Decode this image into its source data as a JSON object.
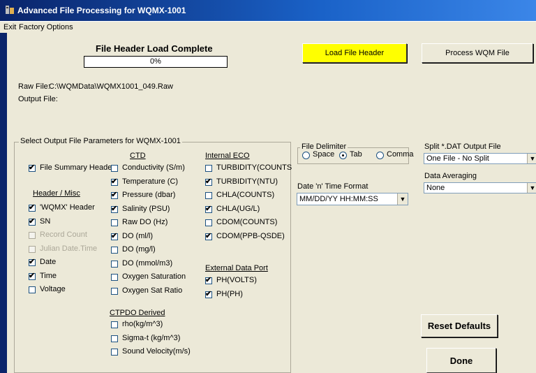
{
  "window": {
    "title": "Advanced File Processing for WQMX-1001"
  },
  "menu": {
    "exit": "Exit",
    "factory_options": "Factory Options"
  },
  "status": {
    "header": "File Header Load Complete",
    "progress_text": "0%",
    "progress": 0
  },
  "buttons": {
    "load_header": "Load File Header",
    "process": "Process WQM File",
    "reset": "Reset Defaults",
    "done": "Done"
  },
  "files": {
    "raw_label": "Raw File:",
    "raw_value": "C:\\WQMData\\WQMX1001_049.Raw",
    "output_label": "Output File:"
  },
  "params": {
    "title": "Select Output File Parameters for WQMX-1001",
    "file_summary": {
      "label": "File Summary Header",
      "checked": true
    },
    "header_misc": {
      "title": "Header / Misc",
      "items": [
        {
          "label": "'WQMX' Header",
          "checked": true,
          "enabled": true
        },
        {
          "label": "SN",
          "checked": true,
          "enabled": true
        },
        {
          "label": "Record Count",
          "checked": false,
          "enabled": false
        },
        {
          "label": "Julian Date.Time",
          "checked": false,
          "enabled": false
        },
        {
          "label": "Date",
          "checked": true,
          "enabled": true
        },
        {
          "label": "Time",
          "checked": true,
          "enabled": true
        },
        {
          "label": "Voltage",
          "checked": false,
          "enabled": true
        }
      ]
    },
    "ctd": {
      "title": "CTD",
      "items": [
        {
          "label": "Conductivity (S/m)",
          "checked": false
        },
        {
          "label": "Temperature (C)",
          "checked": true
        },
        {
          "label": "Pressure (dbar)",
          "checked": true
        },
        {
          "label": "Salinity (PSU)",
          "checked": true
        },
        {
          "label": "Raw DO (Hz)",
          "checked": false
        },
        {
          "label": "DO (ml/l)",
          "checked": true
        },
        {
          "label": "DO (mg/l)",
          "checked": false
        },
        {
          "label": "DO (mmol/m3)",
          "checked": false
        },
        {
          "label": "Oxygen Saturation",
          "checked": false
        },
        {
          "label": "Oxygen Sat Ratio",
          "checked": false
        }
      ]
    },
    "ctpdo": {
      "title": "CTPDO  Derived",
      "items": [
        {
          "label": "rho(kg/m^3)",
          "checked": false
        },
        {
          "label": "Sigma-t (kg/m^3)",
          "checked": false
        },
        {
          "label": "Sound Velocity(m/s)",
          "checked": false
        }
      ]
    },
    "internal_eco": {
      "title": "Internal ECO",
      "items": [
        {
          "label": "TURBIDITY(COUNTS",
          "checked": false
        },
        {
          "label": "TURBIDITY(NTU)",
          "checked": true
        },
        {
          "label": "CHLA(COUNTS)",
          "checked": false
        },
        {
          "label": "CHLA(UG/L)",
          "checked": true
        },
        {
          "label": "CDOM(COUNTS)",
          "checked": false
        },
        {
          "label": "CDOM(PPB-QSDE)",
          "checked": true
        }
      ]
    },
    "external_port": {
      "title": "External Data Port",
      "items": [
        {
          "label": "PH(VOLTS)",
          "checked": true
        },
        {
          "label": "PH(PH)",
          "checked": true
        }
      ]
    }
  },
  "delimiter": {
    "title": "File Delimiter",
    "options": [
      {
        "label": "Space",
        "selected": false
      },
      {
        "label": "Tab",
        "selected": true
      },
      {
        "label": "Comma",
        "selected": false
      }
    ]
  },
  "datetime": {
    "label": "Date 'n' Time Format",
    "value": "MM/DD/YY HH:MM:SS"
  },
  "split": {
    "label": "Split *.DAT Output File",
    "value": "One File - No Split"
  },
  "averaging": {
    "label": "Data Averaging",
    "value": "None"
  },
  "icons": {
    "app": "app-icon",
    "check": "check-mark",
    "dropdown": "chevron-down-icon"
  }
}
